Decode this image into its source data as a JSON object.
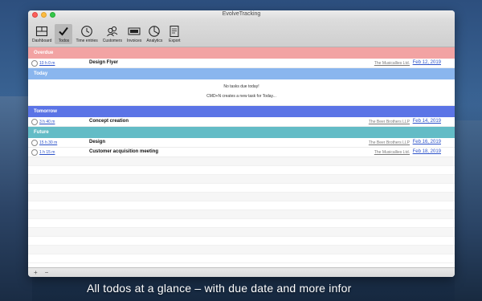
{
  "window": {
    "title": "EvolveTracking"
  },
  "toolbar": {
    "items": [
      {
        "label": "Dashboard",
        "icon": "dashboard-icon"
      },
      {
        "label": "Todos",
        "icon": "checkmark-icon",
        "active": true
      },
      {
        "label": "Time entries",
        "icon": "clock-icon"
      },
      {
        "label": "Customers",
        "icon": "customers-icon"
      },
      {
        "label": "Invoices",
        "icon": "invoice-icon"
      },
      {
        "label": "Analytics",
        "icon": "analytics-icon"
      },
      {
        "label": "Export",
        "icon": "export-icon"
      }
    ]
  },
  "sections": {
    "overdue": {
      "label": "Overdue",
      "color": "#f2a3a3",
      "tasks": [
        {
          "duration": "10 h 0 m",
          "title": "Design Flyer",
          "client": "The Musicallies Ltd.",
          "date": "Feb 12, 2019"
        }
      ]
    },
    "today": {
      "label": "Today",
      "color": "#8ab6ee",
      "empty_line1": "No tasks due today!",
      "empty_line2": "CMD+N creates a new task for Today..."
    },
    "tomorrow": {
      "label": "Tomorrow",
      "color": "#5b74e6",
      "tasks": [
        {
          "duration": "3 h 40 m",
          "title": "Concept creation",
          "client": "The Beer Brothers LLP",
          "date": "Feb 14, 2019"
        }
      ]
    },
    "future": {
      "label": "Future",
      "color": "#63bcc6",
      "tasks": [
        {
          "duration": "15 h 30 m",
          "title": "Design",
          "client": "The Beer Brothers LLP",
          "date": "Feb 16, 2019"
        },
        {
          "duration": "1 h 15 m",
          "title": "Customer acquisition meeting",
          "client": "The Musicallies Ltd.",
          "date": "Feb 18, 2019"
        }
      ]
    }
  },
  "bottombar": {
    "add_label": "+",
    "remove_label": "−"
  },
  "caption": "All todos at a glance – with due date and more infor"
}
